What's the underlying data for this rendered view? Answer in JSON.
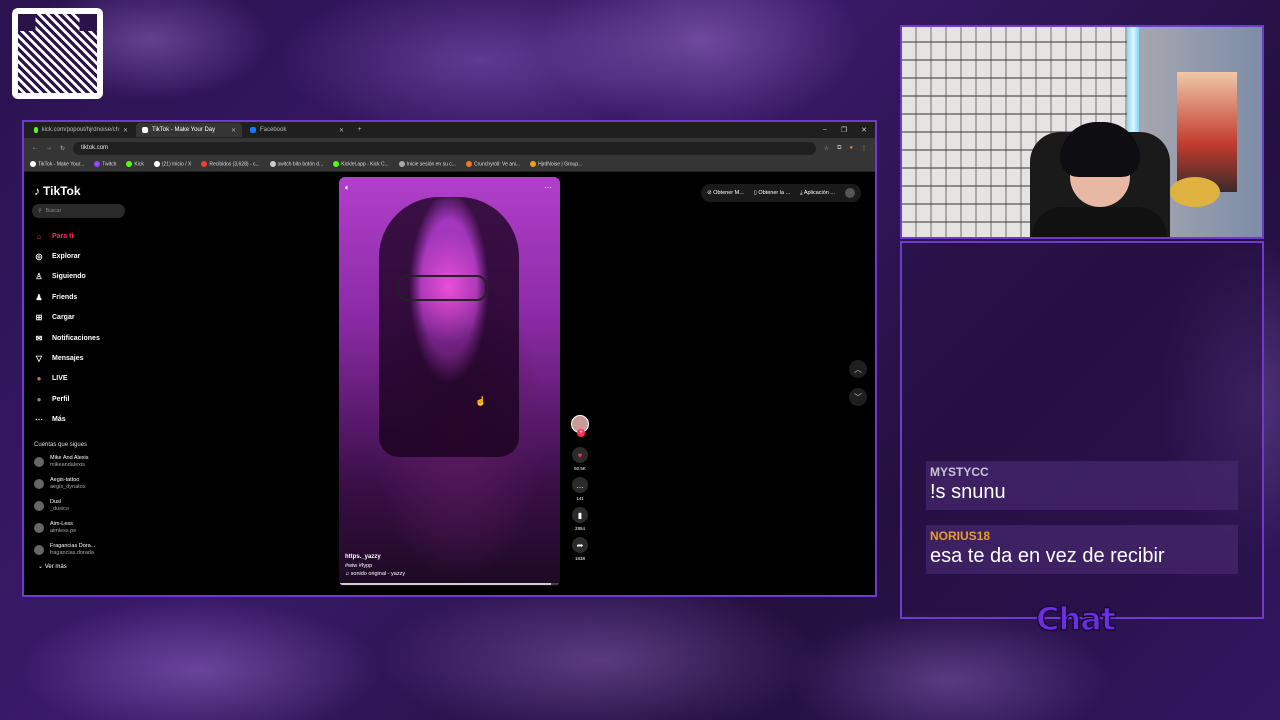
{
  "browser": {
    "tabs": [
      {
        "label": "kick.com/popout/hjrdnoise/ch",
        "color": "#53fc18"
      },
      {
        "label": "TikTok - Make Your Day",
        "color": "#ffffff"
      },
      {
        "label": "Facebook",
        "color": "#1877f2"
      }
    ],
    "url": "tiktok.com",
    "bookmarks": [
      "TikTok - Make Your...",
      "Twitch",
      "Kick",
      "(21) Inicio / X",
      "Recibidos (3,628) - c...",
      "switch bito botón d...",
      "Kicklet.app - Kick C...",
      "Inicie sesión en su c...",
      "Crunchyroll: Ve ani...",
      "HjrdNoise | Group..."
    ]
  },
  "tiktok": {
    "logo": "TikTok",
    "search_placeholder": "Buscar",
    "nav": [
      {
        "label": "Para ti",
        "icon": "home-icon",
        "glyph": "⌂"
      },
      {
        "label": "Explorar",
        "icon": "compass-icon",
        "glyph": "◎"
      },
      {
        "label": "Siguiendo",
        "icon": "following-icon",
        "glyph": "♙"
      },
      {
        "label": "Friends",
        "icon": "friends-icon",
        "glyph": "♟"
      },
      {
        "label": "Cargar",
        "icon": "upload-icon",
        "glyph": "⊞"
      },
      {
        "label": "Notificaciones",
        "icon": "bell-icon",
        "glyph": "✉"
      },
      {
        "label": "Mensajes",
        "icon": "message-icon",
        "glyph": "▽"
      },
      {
        "label": "LIVE",
        "icon": "live-icon",
        "glyph": "●"
      },
      {
        "label": "Perfil",
        "icon": "profile-icon",
        "glyph": "●"
      },
      {
        "label": "Más",
        "icon": "more-icon",
        "glyph": "⋯"
      }
    ],
    "following_title": "Cuentas que sigues",
    "accounts": [
      {
        "name": "Mike And Alexis",
        "handle": "mikeandalexis"
      },
      {
        "name": "Aegis-tattoo",
        "handle": "aegis_dynatos"
      },
      {
        "name": "Dusl",
        "handle": "_dusico"
      },
      {
        "name": "Aim-Less",
        "handle": "aimless.pe"
      },
      {
        "name": "Fragancias Dora...",
        "handle": "fragancias.dorada"
      }
    ],
    "see_more": "Ver más",
    "top_buttons": [
      "Obtener M...",
      "Obtener la ...",
      "Aplicación ..."
    ],
    "video": {
      "author": "https._yazzy",
      "tags": "#wiw  #fypp",
      "sound": "♫ sonido original - yazzy",
      "likes": "60.5K",
      "comments": "141",
      "saves": "2854",
      "shares": "1838"
    }
  },
  "chat": {
    "messages": [
      {
        "user": "MYSTYCC",
        "text": "!s snunu",
        "color": "#c9c3d6"
      },
      {
        "user": "NORIUS18",
        "text": "esa te da en vez de recibir",
        "color": "#e6a020"
      }
    ],
    "label": "Chat"
  }
}
